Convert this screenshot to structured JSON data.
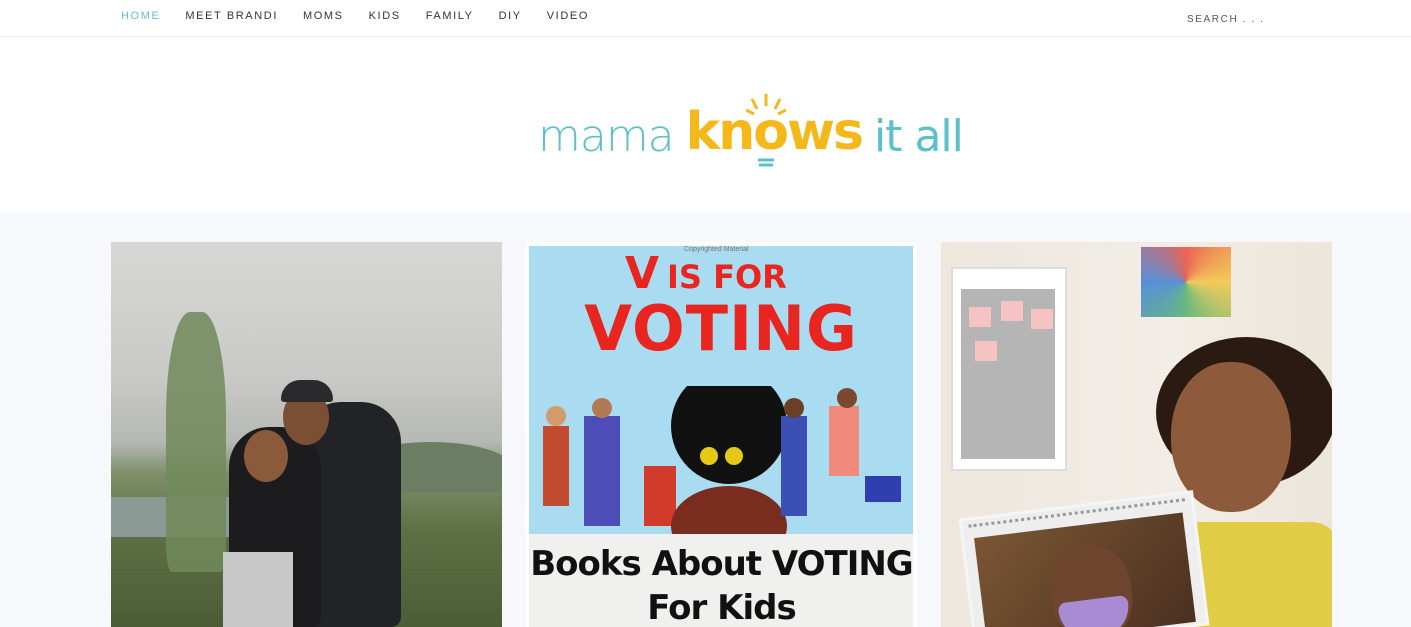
{
  "nav": {
    "items": [
      {
        "label": "HOME",
        "active": true
      },
      {
        "label": "MEET BRANDI",
        "active": false
      },
      {
        "label": "MOMS",
        "active": false
      },
      {
        "label": "KIDS",
        "active": false
      },
      {
        "label": "FAMILY",
        "active": false
      },
      {
        "label": "DIY",
        "active": false
      },
      {
        "label": "VIDEO",
        "active": false
      }
    ],
    "search_placeholder": "SEARCH . . ."
  },
  "logo": {
    "word1": "mama",
    "word2": "knows",
    "word3": "it all",
    "colors": {
      "teal": "#5bc0c8",
      "yellow": "#f5b81b"
    }
  },
  "posts": [
    {
      "image": "couple-outdoor-photo"
    },
    {
      "image": "v-is-for-voting-book",
      "book_copyright": "Copyrighted Material",
      "book_title_v": "V",
      "book_title_is_for": "IS FOR",
      "book_title_voting": "VOTING",
      "caption_line1": "Books About VOTING",
      "caption_line2": "For Kids"
    },
    {
      "image": "girl-with-calendar-photo"
    }
  ],
  "colors": {
    "accent": "#5fc0cf",
    "band_bg": "#f6f8fb",
    "book_red": "#e8251f",
    "book_bg": "#a9dcf1"
  }
}
